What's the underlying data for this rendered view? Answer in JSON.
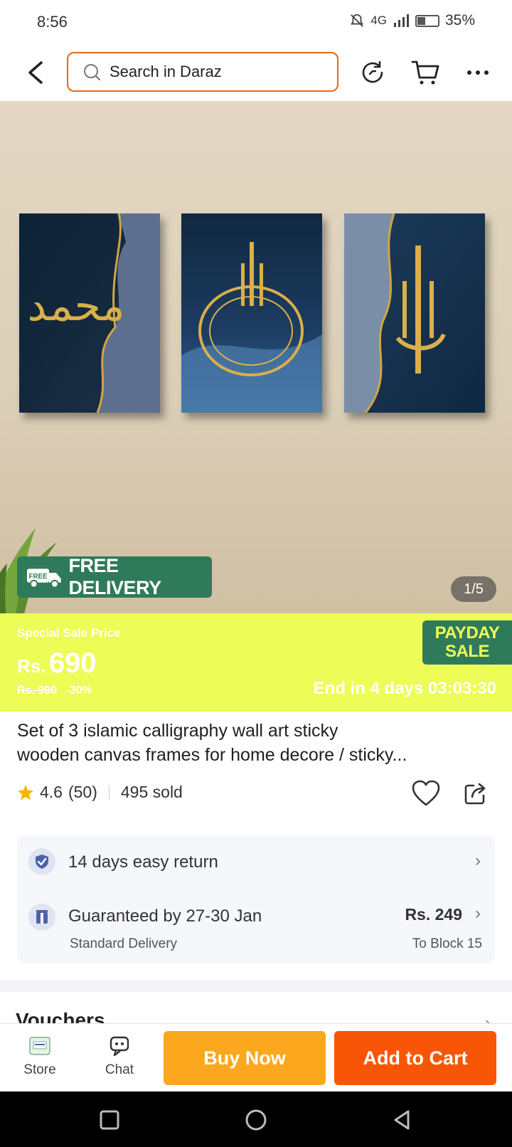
{
  "status": {
    "time": "8:56",
    "network": "4G",
    "battery": "35%"
  },
  "search": {
    "placeholder": "Search in Daraz"
  },
  "hero": {
    "badge": "FREE DELIVERY",
    "badge_icon_text": "FREE",
    "pager": "1/5"
  },
  "sale": {
    "label": "Special Sale Price",
    "currency": "Rs.",
    "price": "690",
    "old_price": "Rs. 990",
    "discount": "-30%",
    "countdown": "End in 4 days 03:03:30",
    "campaign_line1": "PAYDAY",
    "campaign_line2": "SALE"
  },
  "product": {
    "title_line1": "Set of 3 islamic calligraphy wall art sticky",
    "title_line2": "wooden canvas  frames for home decore / sticky...",
    "rating": "4.6",
    "reviews": "(50)",
    "sold": "495 sold"
  },
  "service": {
    "return_text": "14 days easy return",
    "delivery_text": "Guaranteed by 27-30 Jan",
    "delivery_type": "Standard Delivery",
    "delivery_price": "Rs. 249",
    "destination": "To Block 15"
  },
  "vouchers": {
    "title": "Vouchers"
  },
  "actions": {
    "store": "Store",
    "chat": "Chat",
    "buy_now": "Buy Now",
    "add_to_cart": "Add to Cart"
  },
  "colors": {
    "brand": "#f85606",
    "buy": "#fba81f",
    "sale_bg": "#edfc57",
    "green": "#2f7a5b"
  }
}
